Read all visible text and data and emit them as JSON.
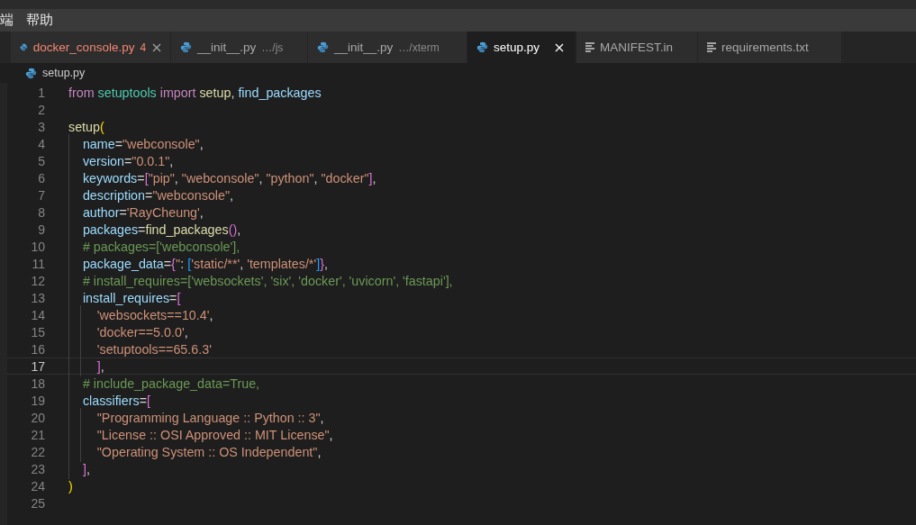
{
  "menu": [
    {
      "label": "端"
    },
    {
      "label": "帮助"
    }
  ],
  "tabs": [
    {
      "label": "docker_console.py",
      "kind": "python",
      "selected": false,
      "error": true,
      "badge": "4",
      "closable": true
    },
    {
      "label": "__init__.py",
      "detail": "…/js",
      "kind": "python",
      "selected": false,
      "error": false,
      "closable": false
    },
    {
      "label": "__init__.py",
      "detail": "…/xterm",
      "kind": "python",
      "selected": false,
      "error": false,
      "closable": false
    },
    {
      "label": "setup.py",
      "kind": "python",
      "selected": true,
      "error": false,
      "closable": true
    },
    {
      "label": "MANIFEST.in",
      "kind": "text",
      "selected": false,
      "error": false,
      "closable": false
    },
    {
      "label": "requirements.txt",
      "kind": "text",
      "selected": false,
      "error": false,
      "closable": false
    }
  ],
  "breadcrumb": {
    "label": "setup.py",
    "kind": "python"
  },
  "lines": [
    {
      "number": "1",
      "current": false,
      "tokens": [
        {
          "kind": "keyword",
          "text": "from"
        },
        {
          "kind": "module",
          "text": " setuptools"
        },
        {
          "kind": "keyword",
          "text": " import"
        },
        {
          "kind": "func",
          "text": " setup"
        },
        {
          "kind": "punct",
          "text": ","
        },
        {
          "kind": "var",
          "text": " find_packages"
        }
      ]
    },
    {
      "number": "2",
      "current": false
    },
    {
      "number": "3",
      "current": false,
      "tokens": [
        {
          "kind": "func",
          "text": "setup"
        },
        {
          "kind": "bracket1",
          "text": "("
        }
      ]
    },
    {
      "number": "4",
      "current": false,
      "tokens": [
        {
          "kind": "var",
          "text": "  name"
        },
        {
          "kind": "punct",
          "text": "="
        },
        {
          "kind": "string",
          "text": "\"webconsole\""
        },
        {
          "kind": "punct",
          "text": ","
        }
      ]
    },
    {
      "number": "5",
      "current": false,
      "tokens": [
        {
          "kind": "var",
          "text": "  version"
        },
        {
          "kind": "punct",
          "text": "="
        },
        {
          "kind": "string",
          "text": "\"0.0.1\""
        },
        {
          "kind": "punct",
          "text": ","
        }
      ]
    },
    {
      "number": "6",
      "current": false,
      "tokens": [
        {
          "kind": "var",
          "text": "  keywords"
        },
        {
          "kind": "punct",
          "text": "="
        },
        {
          "kind": "bracket2",
          "text": "["
        },
        {
          "kind": "string",
          "text": "\"pip\""
        },
        {
          "kind": "punct",
          "text": ", "
        },
        {
          "kind": "string",
          "text": "\"webconsole\""
        },
        {
          "kind": "punct",
          "text": ", "
        },
        {
          "kind": "string",
          "text": "\"python\""
        },
        {
          "kind": "punct",
          "text": ", "
        },
        {
          "kind": "string",
          "text": "\"docker\""
        },
        {
          "kind": "bracket2",
          "text": "]"
        },
        {
          "kind": "punct",
          "text": ","
        }
      ]
    },
    {
      "number": "7",
      "current": false,
      "tokens": [
        {
          "kind": "var",
          "text": "  description"
        },
        {
          "kind": "punct",
          "text": "="
        },
        {
          "kind": "string",
          "text": "\"webconsole\""
        },
        {
          "kind": "punct",
          "text": ","
        }
      ]
    },
    {
      "number": "8",
      "current": false,
      "tokens": [
        {
          "kind": "var",
          "text": "  author"
        },
        {
          "kind": "punct",
          "text": "="
        },
        {
          "kind": "string",
          "text": "'RayCheung'"
        },
        {
          "kind": "punct",
          "text": ","
        }
      ]
    },
    {
      "number": "9",
      "current": false,
      "tokens": [
        {
          "kind": "var",
          "text": "  packages"
        },
        {
          "kind": "punct",
          "text": "="
        },
        {
          "kind": "func",
          "text": "find_packages"
        },
        {
          "kind": "bracket2",
          "text": "()"
        },
        {
          "kind": "punct",
          "text": ","
        }
      ]
    },
    {
      "number": "10",
      "current": false,
      "tokens": [
        {
          "kind": "comment",
          "text": "  # packages=['webconsole'],"
        }
      ]
    },
    {
      "number": "11",
      "current": false,
      "tokens": [
        {
          "kind": "var",
          "text": "  package_data"
        },
        {
          "kind": "punct",
          "text": "="
        },
        {
          "kind": "bracket2",
          "text": "{"
        },
        {
          "kind": "string",
          "text": "''"
        },
        {
          "kind": "punct",
          "text": ": "
        },
        {
          "kind": "bracket3",
          "text": "["
        },
        {
          "kind": "string",
          "text": "'static/**'"
        },
        {
          "kind": "punct",
          "text": ", "
        },
        {
          "kind": "string",
          "text": "'templates/*'"
        },
        {
          "kind": "bracket3",
          "text": "]"
        },
        {
          "kind": "bracket2",
          "text": "}"
        },
        {
          "kind": "punct",
          "text": ","
        }
      ]
    },
    {
      "number": "12",
      "current": false,
      "tokens": [
        {
          "kind": "comment",
          "text": "  # install_requires=['websockets', 'six', 'docker', 'uvicorn', 'fastapi'],"
        }
      ]
    },
    {
      "number": "13",
      "current": false,
      "tokens": [
        {
          "kind": "var",
          "text": "  install_requires"
        },
        {
          "kind": "punct",
          "text": "="
        },
        {
          "kind": "bracket2",
          "text": "["
        }
      ]
    },
    {
      "number": "14",
      "current": false,
      "tokens": [
        {
          "kind": "string",
          "text": "    'websockets==10.4'"
        },
        {
          "kind": "punct",
          "text": ","
        }
      ]
    },
    {
      "number": "15",
      "current": false,
      "tokens": [
        {
          "kind": "string",
          "text": "    'docker==5.0.0'"
        },
        {
          "kind": "punct",
          "text": ","
        }
      ]
    },
    {
      "number": "16",
      "current": false,
      "tokens": [
        {
          "kind": "string",
          "text": "    'setuptools==65.6.3'"
        }
      ]
    },
    {
      "number": "17",
      "current": true,
      "tokens": [
        {
          "kind": "bracket2",
          "text": "    ]"
        },
        {
          "kind": "punct",
          "text": ","
        }
      ]
    },
    {
      "number": "18",
      "current": false,
      "tokens": [
        {
          "kind": "comment",
          "text": "  # include_package_data=True,"
        }
      ]
    },
    {
      "number": "19",
      "current": false,
      "tokens": [
        {
          "kind": "var",
          "text": "  classifiers"
        },
        {
          "kind": "punct",
          "text": "="
        },
        {
          "kind": "bracket2",
          "text": "["
        }
      ]
    },
    {
      "number": "20",
      "current": false,
      "tokens": [
        {
          "kind": "string",
          "text": "    \"Programming Language :: Python :: 3\""
        },
        {
          "kind": "punct",
          "text": ","
        }
      ]
    },
    {
      "number": "21",
      "current": false,
      "tokens": [
        {
          "kind": "string",
          "text": "    \"License :: OSI Approved :: MIT License\""
        },
        {
          "kind": "punct",
          "text": ","
        }
      ]
    },
    {
      "number": "22",
      "current": false,
      "tokens": [
        {
          "kind": "string",
          "text": "    \"Operating System :: OS Independent\""
        },
        {
          "kind": "punct",
          "text": ","
        }
      ]
    },
    {
      "number": "23",
      "current": false,
      "tokens": [
        {
          "kind": "bracket2",
          "text": "  ]"
        },
        {
          "kind": "punct",
          "text": ","
        }
      ]
    },
    {
      "number": "24",
      "current": false,
      "tokens": [
        {
          "kind": "bracket1",
          "text": ")"
        }
      ]
    },
    {
      "number": "25",
      "current": false
    }
  ]
}
